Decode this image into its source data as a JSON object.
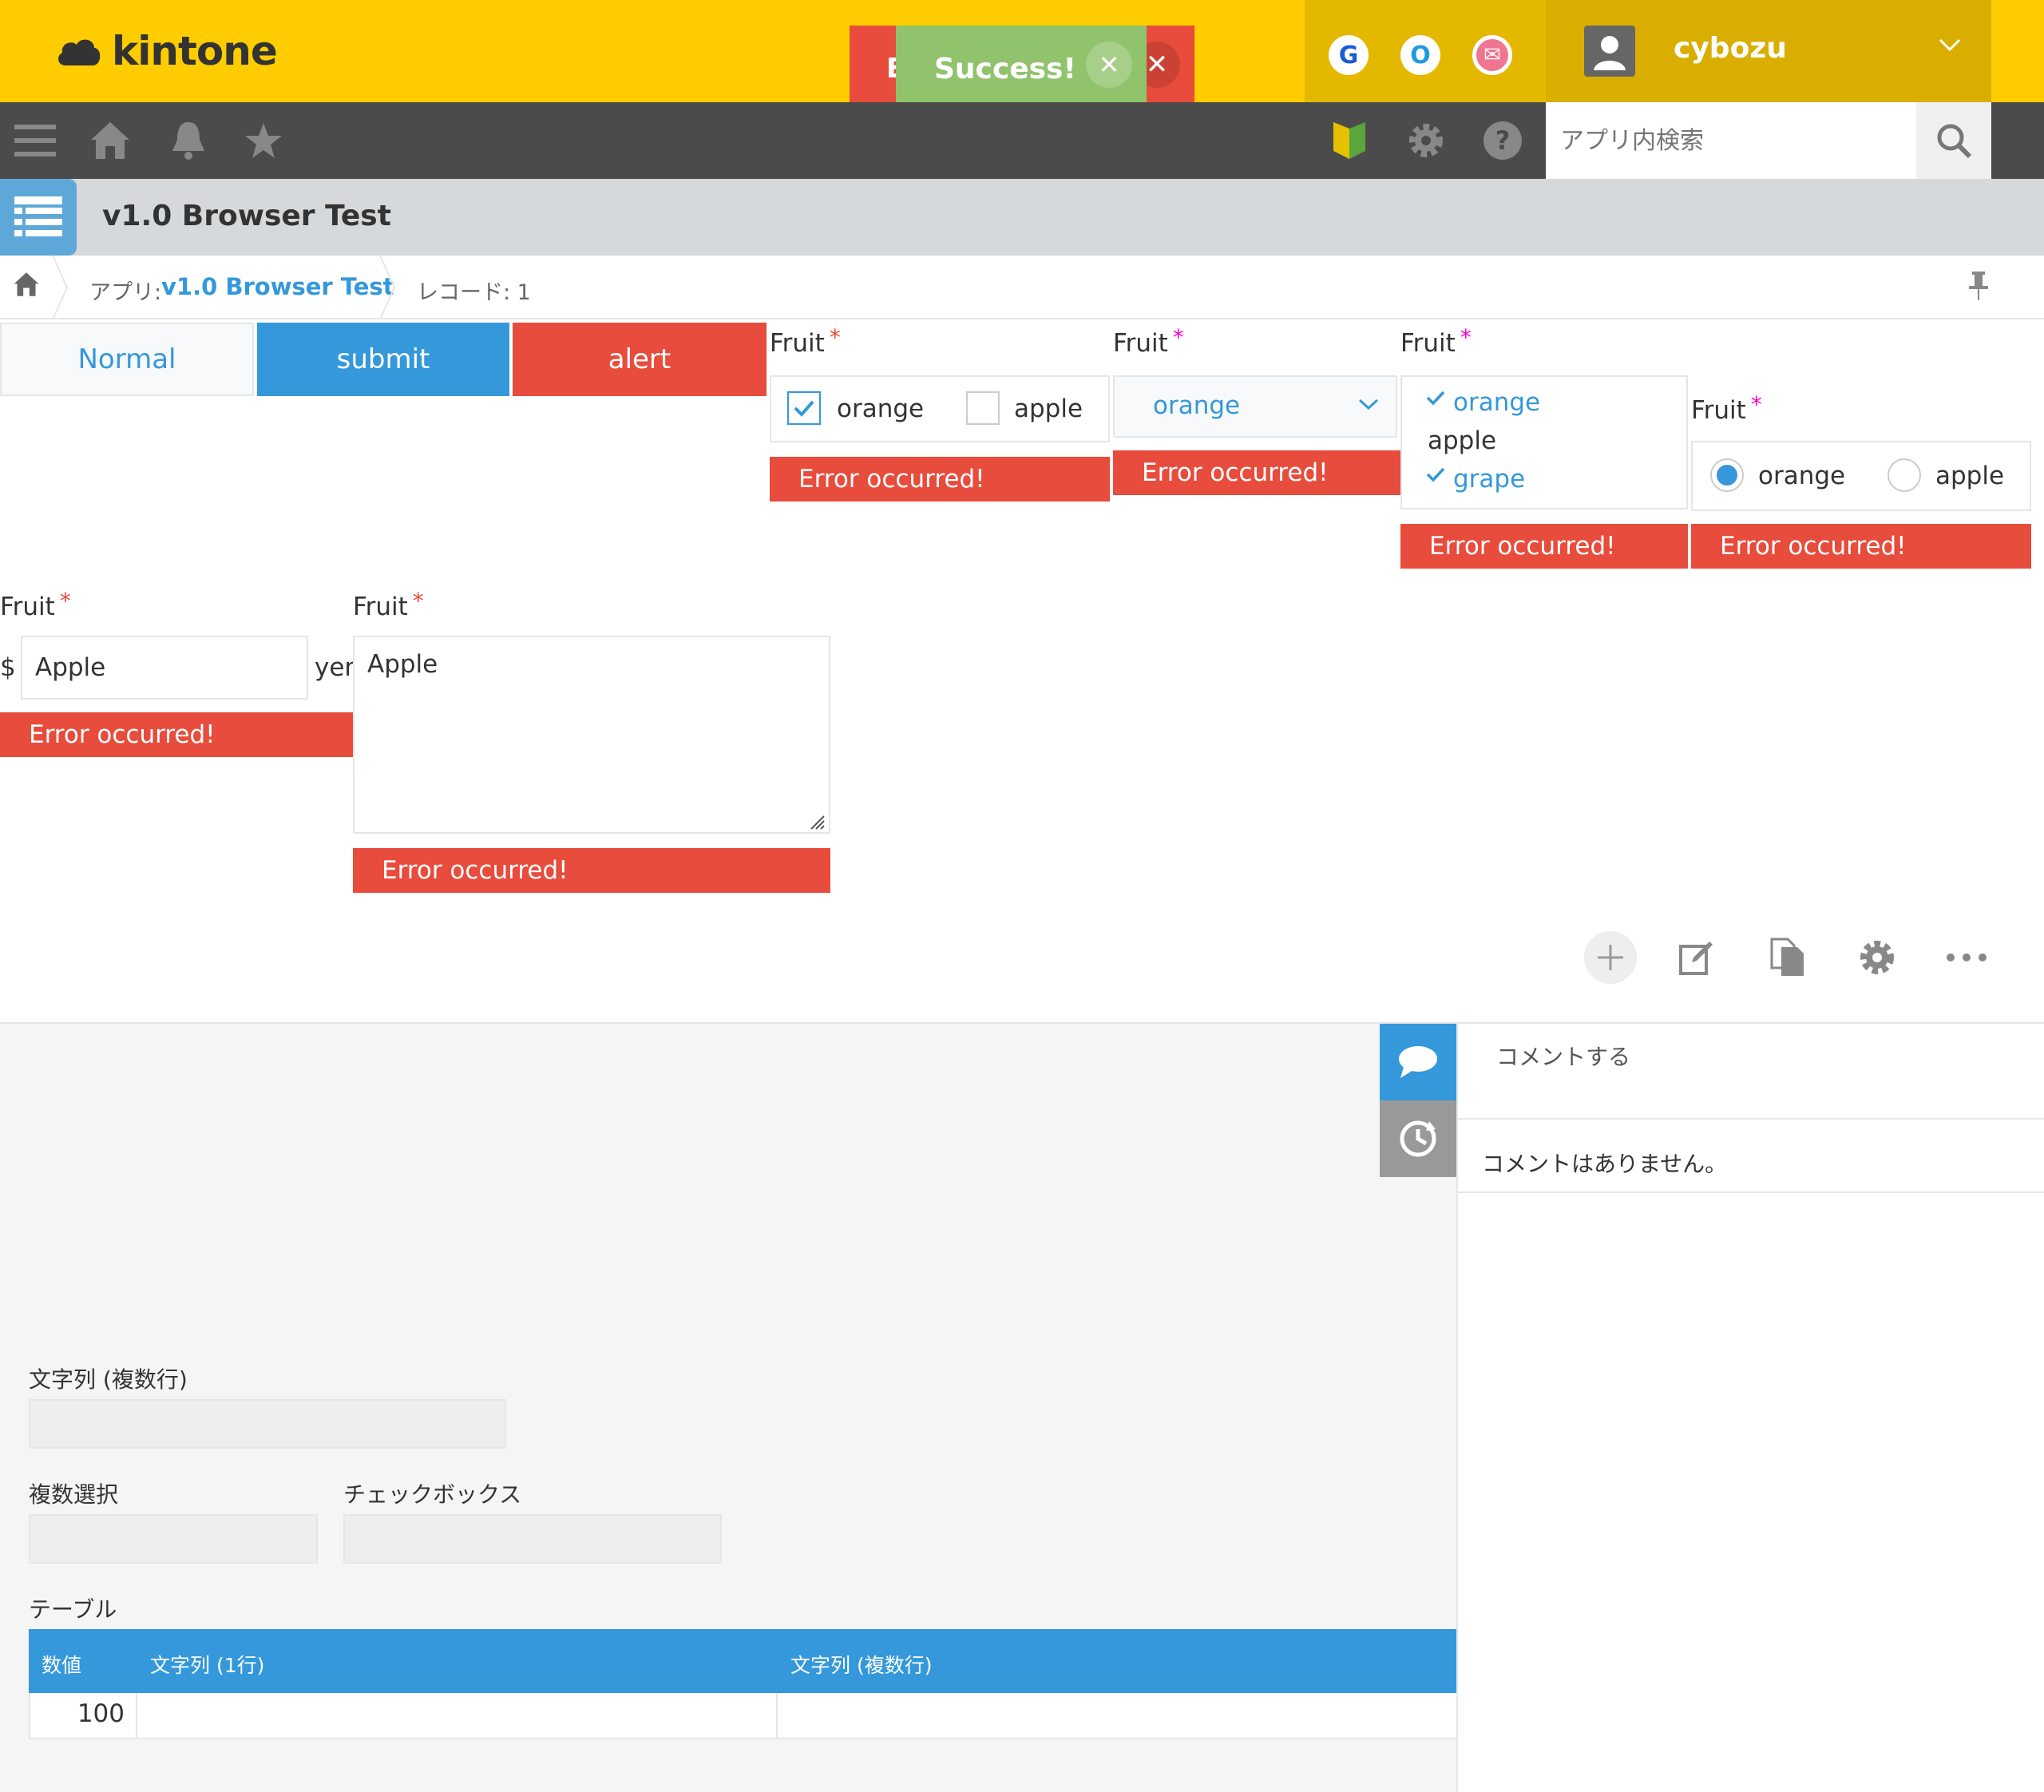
{
  "header": {
    "logo_text": "kintone",
    "services": [
      "G",
      "O",
      "✉"
    ],
    "username": "cybozu"
  },
  "notifications": {
    "error_letter": "E",
    "success_text": "Success!"
  },
  "toolbar": {
    "search_placeholder": "アプリ内検索"
  },
  "app": {
    "title": "v1.0 Browser Test"
  },
  "breadcrumb": {
    "app_prefix": "アプリ:",
    "app_name": "v1.0 Browser Test",
    "record": "レコード: 1"
  },
  "buttons": {
    "normal": "Normal",
    "submit": "submit",
    "alert": "alert"
  },
  "fields": {
    "checkbox": {
      "label": "Fruit",
      "required": "*",
      "options": [
        "orange",
        "apple"
      ],
      "checked": [
        "orange"
      ],
      "error": "Error occurred!"
    },
    "dropdown": {
      "label": "Fruit",
      "required": "*",
      "value": "orange",
      "error": "Error occurred!"
    },
    "multichoice": {
      "label": "Fruit",
      "required": "*",
      "options": [
        "orange",
        "apple",
        "grape"
      ],
      "selected": [
        "orange",
        "grape"
      ],
      "error": "Error occurred!"
    },
    "radio": {
      "label": "Fruit",
      "required": "*",
      "options": [
        "orange",
        "apple"
      ],
      "selected": "orange",
      "error": "Error occurred!"
    },
    "text": {
      "label": "Fruit",
      "required": "*",
      "prefix": "$",
      "value": "Apple",
      "suffix": "yen",
      "error": "Error occurred!"
    },
    "textarea": {
      "label": "Fruit",
      "required": "*",
      "value": "Apple",
      "error": "Error occurred!"
    }
  },
  "side": {
    "comment_placeholder": "コメントする",
    "no_comments": "コメントはありません。"
  },
  "form": {
    "multiline_label": "文字列 (複数行)",
    "multiselect_label": "複数選択",
    "checkbox_label": "チェックボックス",
    "table_label": "テーブル",
    "table_headers": [
      "数値",
      "文字列 (1行)",
      "文字列 (複数行)"
    ],
    "table_rows": [
      [
        "100",
        "",
        ""
      ]
    ]
  },
  "colors": {
    "header": "#ffcc00",
    "primary": "#3498db",
    "error": "#e74c3c",
    "success": "#91c36c",
    "toolbar": "#4b4b4b"
  }
}
